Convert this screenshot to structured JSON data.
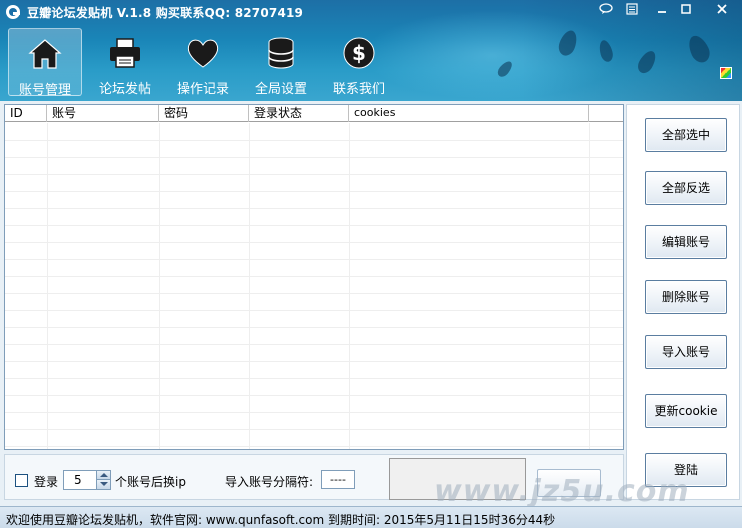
{
  "app": {
    "title": "豆瓣论坛发贴机 V.1.8 购买联系QQ: 82707419"
  },
  "toolbar": {
    "items": [
      {
        "label": "账号管理",
        "icon": "home-icon"
      },
      {
        "label": "论坛发帖",
        "icon": "printer-icon"
      },
      {
        "label": "操作记录",
        "icon": "heart-icon"
      },
      {
        "label": "全局设置",
        "icon": "database-icon"
      },
      {
        "label": "联系我们",
        "icon": "dollar-icon"
      }
    ]
  },
  "grid": {
    "columns": [
      "ID",
      "账号",
      "密码",
      "登录状态",
      "cookies"
    ],
    "rows": []
  },
  "side_buttons": {
    "select_all": "全部选中",
    "invert_select": "全部反选",
    "edit_account": "编辑账号",
    "delete_account": "删除账号",
    "import_account": "导入账号",
    "update_cookie": "更新cookie",
    "login": "登陆"
  },
  "options": {
    "login_label": "登录",
    "switch_count": "5",
    "switch_suffix": "个账号后换ip",
    "separator_label": "导入账号分隔符:",
    "separator_value": "----"
  },
  "status": {
    "text": "欢迎使用豆瓣论坛发贴机，软件官网: www.qunfasoft.com 到期时间: 2015年5月11日15时36分44秒"
  },
  "watermark": "www.jz5u.com"
}
